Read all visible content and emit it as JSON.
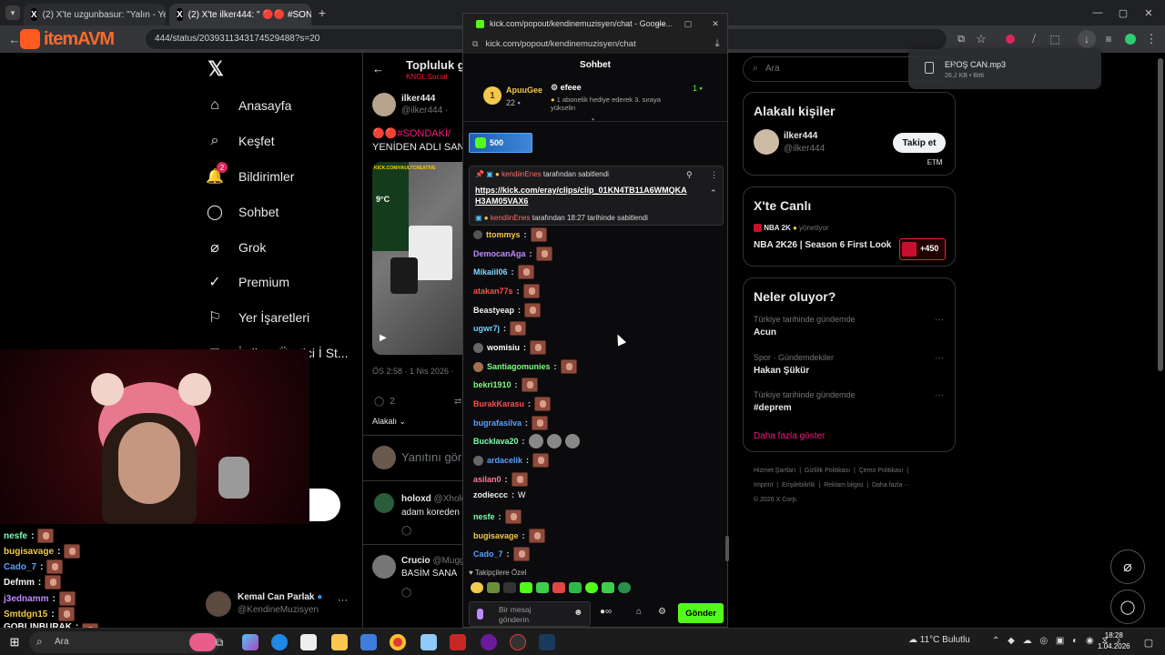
{
  "browser": {
    "tabs": [
      {
        "label": "(2) X'te uzgunbasur: \"Yalın - Yen"
      },
      {
        "label": "(2) X'te ilker444: \" 🔴🔴 #SONDAK"
      }
    ],
    "address": "444/status/2039311343174529488?s=20",
    "logo_text": "itemAVM"
  },
  "download": {
    "filename": "EROŞ CAN.mp3",
    "meta": "26,2 KB • Bitti"
  },
  "x_nav": {
    "items": [
      {
        "label": "Anasayfa",
        "icon": "home-icon"
      },
      {
        "label": "Keşfet",
        "icon": "search-icon"
      },
      {
        "label": "Bildirimler",
        "icon": "bell-icon",
        "badge": "2"
      },
      {
        "label": "Sohbet",
        "icon": "chat-icon"
      },
      {
        "label": "Grok",
        "icon": "grok-icon"
      },
      {
        "label": "Premium",
        "icon": "premium-icon"
      },
      {
        "label": "Yer İşaretleri",
        "icon": "bookmark-icon"
      },
      {
        "label": "İş ilanı Üretici İ St...",
        "icon": "briefcase-icon"
      }
    ],
    "account": {
      "name": "Kemal Can Parlak",
      "handle": "@KendineMuzisyen"
    }
  },
  "post": {
    "header_title": "Topluluk g",
    "header_sub": "KNGL Social",
    "author_name": "ilker444",
    "author_handle": "@ilker444 ·",
    "text1": "🔴🔴#SONDAKİ/",
    "text2": "YENİDEN ADLI SAN",
    "timestamp": "ÖS 2:58 · 1 Nis 2026 ·",
    "reply_count": "2",
    "sort_label": "Alakalı",
    "reply_placeholder": "Yanıtını gör",
    "replies": [
      {
        "name": "holoxd",
        "handle": "@Xholc",
        "text": "adam koreden"
      },
      {
        "name": "Crucio",
        "handle": "@Mugg",
        "text": "BASİM SANA"
      }
    ],
    "media": {
      "url_text": "KICK.COM/VAULTCREATIVE",
      "temp": "9°C"
    }
  },
  "right": {
    "search_placeholder": "Ara",
    "people_title": "Alakalı kişiler",
    "person_name": "ilker444",
    "person_handle": "@ilker444",
    "follow_label": "Takip et",
    "person_tag": "ᎬᎢᎷ",
    "live_title": "X'te Canlı",
    "live_host": "NBA 2K",
    "live_role": "yönetiyor",
    "live_text": "NBA 2K26 | Season 6 First Look",
    "live_count": "+450",
    "trends_title": "Neler oluyor?",
    "trends": [
      {
        "context": "Türkiye tarihinde gündemde",
        "name": "Acun"
      },
      {
        "context": "Spor · Gündemdekiler",
        "name": "Hakan Şükür"
      },
      {
        "context": "Türkiye tarihinde gündemde",
        "name": "#deprem"
      }
    ],
    "show_more": "Daha fazla göster",
    "footer": [
      "Hizmet Şartları",
      "|",
      "Gizlilik Politikası",
      "|",
      "Çerez Politikası",
      "|",
      "Imprint",
      "|",
      "Erişilebilirlik",
      "|",
      "Reklam bilgisi",
      "|",
      "Daha fazla ···",
      "© 2026 X Corp."
    ]
  },
  "chat": {
    "window_title": "kick.com/popout/kendinemuzisyen/chat - Google...",
    "url": "kick.com/popout/kendinemuzisyen/chat",
    "header": "Sohbet",
    "top_gifter": {
      "rank": "1",
      "name": "ApuuGee",
      "amount": "22"
    },
    "gift_user": "efeee",
    "gift_text": "1 abonelik hediye ederek 3. sıraya yükselin",
    "gift_count": "1",
    "kicks": "500",
    "pinned_by": "kendiinEnes",
    "pinned_suffix": "tarafından sabitlendi",
    "pinned_link": "https://kick.com/eray/clips/clip_01KN4TB11A6WMQKAH3AM05VAX6",
    "pinned_footer_user": "kendiinEnes",
    "pinned_footer_text": "tarafından 18:27 tarihinde sabitlendi",
    "messages": [
      {
        "user": "ttommys",
        "color": "#f2c94c",
        "text": ""
      },
      {
        "user": "DemocanAga",
        "color": "#c08bff",
        "text": ""
      },
      {
        "user": "Mikaiil06",
        "color": "#7fd6ff",
        "text": ""
      },
      {
        "user": "atakan77s",
        "color": "#ff4d4d",
        "text": ""
      },
      {
        "user": "Beastyeap",
        "color": "#f2f2f2",
        "text": ""
      },
      {
        "user": "ugwr7j",
        "color": "#6fd1ff",
        "text": ""
      },
      {
        "user": "womisiu",
        "color": "#ffffff",
        "text": ""
      },
      {
        "user": "Santiagomunies",
        "color": "#7dff7d",
        "text": ""
      },
      {
        "user": "bekri1910",
        "color": "#7dff7d",
        "text": ""
      },
      {
        "user": "BurakKarasu",
        "color": "#ff4d4d",
        "text": ""
      },
      {
        "user": "bugrafasilva",
        "color": "#5aa0ff",
        "text": ""
      },
      {
        "user": "Bucklava20",
        "color": "#7dffb0",
        "text": ""
      },
      {
        "user": "ardacelik",
        "color": "#5aa0ff",
        "text": ""
      },
      {
        "user": "asilan0",
        "color": "#ff7b9c",
        "text": ""
      },
      {
        "user": "zodieccc",
        "color": "#f2f2f2",
        "text": "W"
      },
      {
        "user": "nesfe",
        "color": "#7dffb0",
        "text": ""
      },
      {
        "user": "bugisavage",
        "color": "#f2c94c",
        "text": ""
      },
      {
        "user": "Cado_7",
        "color": "#5aa0ff",
        "text": ""
      }
    ],
    "pinned_emotes_label": "Takipçilere Özel",
    "input_placeholder": "Bir mesaj gönderin",
    "send_label": "Gönder"
  },
  "overlay_chat": [
    {
      "user": "nesfe",
      "color": "#7dffb0"
    },
    {
      "user": "bugisavage",
      "color": "#f2c94c"
    },
    {
      "user": "Cado_7",
      "color": "#5aa0ff"
    },
    {
      "user": "Defmm",
      "color": "#f2f2f2"
    },
    {
      "user": "j3ednamm",
      "color": "#c08bff"
    },
    {
      "user": "Smtdgn15",
      "color": "#f2c94c"
    },
    {
      "user": "GOBLINBURAK",
      "color": "#f2f2f2"
    }
  ],
  "taskbar": {
    "search": "Ara",
    "weather": "11°C  Bulutlu",
    "time": "18:28",
    "date": "1.04.2026"
  }
}
